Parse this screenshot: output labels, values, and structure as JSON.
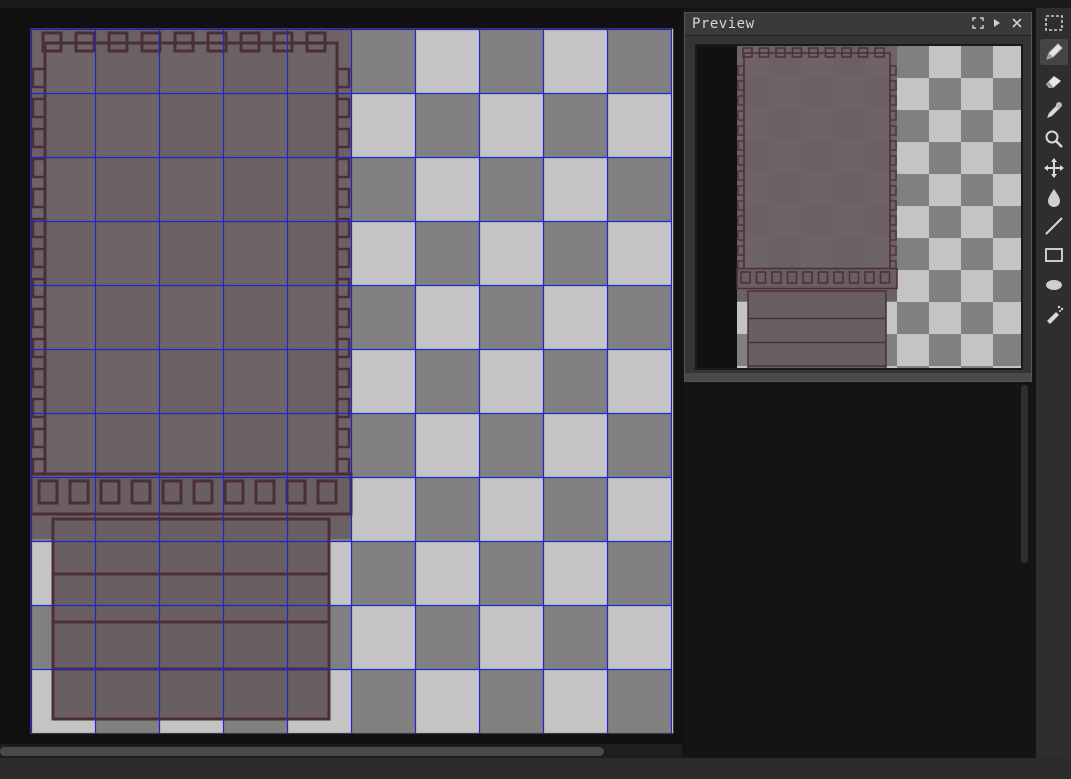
{
  "app": {
    "colors": {
      "background": "#111111",
      "checker_light": "#c4c4c4",
      "checker_dark": "#808080",
      "grid_line": "#2222dd",
      "sprite_fill": "#6a5f60",
      "sprite_outline": "#4a2f38",
      "panel_bg": "#343434",
      "toolbar_bg": "#2e2e2e"
    }
  },
  "canvas": {
    "grid_columns": 10,
    "grid_rows": 11,
    "grid_visible": true
  },
  "preview": {
    "title": "Preview",
    "buttons": [
      "expand-icon",
      "play-icon",
      "close-icon"
    ]
  },
  "toolbar": {
    "tools": [
      {
        "icon": "marquee-select-icon",
        "active": false
      },
      {
        "icon": "pencil-icon",
        "active": true
      },
      {
        "icon": "eraser-icon",
        "active": false
      },
      {
        "icon": "eyedropper-icon",
        "active": false
      },
      {
        "icon": "zoom-icon",
        "active": false
      },
      {
        "icon": "move-icon",
        "active": false
      },
      {
        "icon": "paint-bucket-icon",
        "active": false
      },
      {
        "icon": "line-icon",
        "active": false
      },
      {
        "icon": "rectangle-icon",
        "active": false
      },
      {
        "icon": "blob-icon",
        "active": false
      },
      {
        "icon": "spray-icon",
        "active": false
      }
    ]
  }
}
